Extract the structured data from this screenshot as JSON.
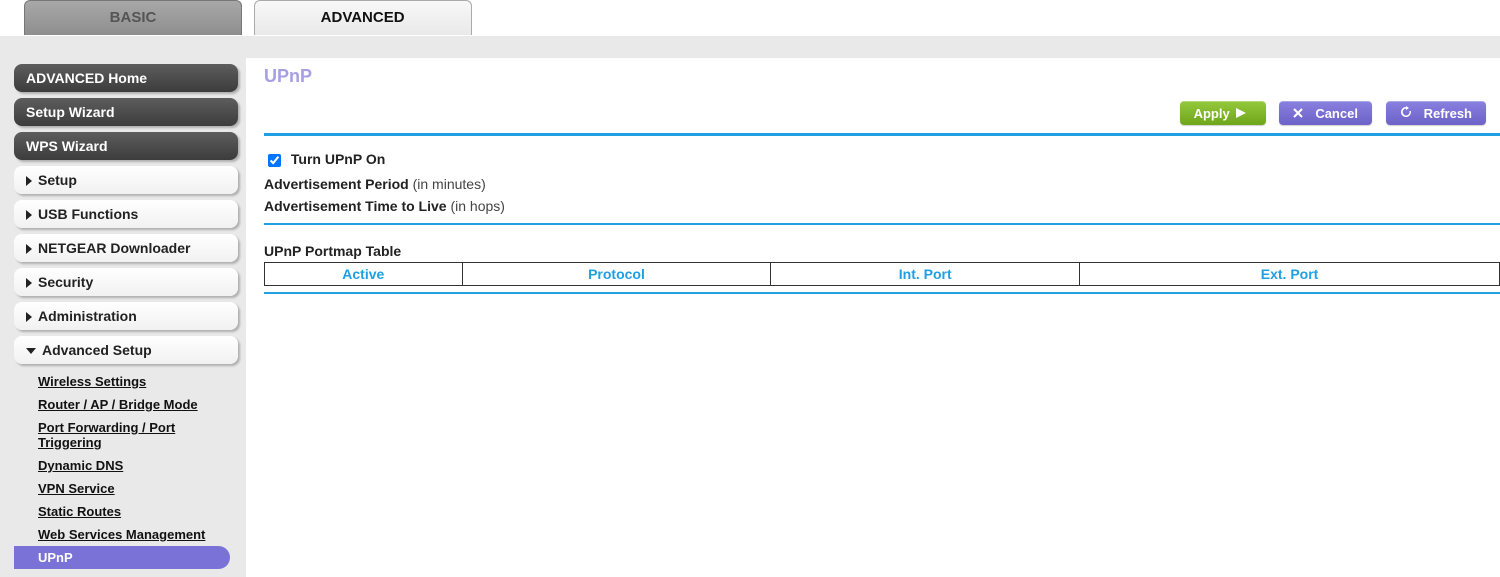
{
  "tabs": {
    "basic": "BASIC",
    "advanced": "ADVANCED"
  },
  "sidebar": {
    "advanced_home": "ADVANCED Home",
    "setup_wizard": "Setup Wizard",
    "wps_wizard": "WPS Wizard",
    "setup": "Setup",
    "usb": "USB Functions",
    "downloader": "NETGEAR Downloader",
    "security": "Security",
    "administration": "Administration",
    "adv_setup": "Advanced Setup",
    "subs": {
      "wireless": "Wireless Settings",
      "mode": "Router / AP / Bridge Mode",
      "portfwd": "Port Forwarding / Port Triggering",
      "ddns": "Dynamic DNS",
      "vpn": "VPN Service",
      "routes": "Static Routes",
      "wsm": "Web Services Management",
      "upnp": "UPnP"
    }
  },
  "page": {
    "title": "UPnP",
    "apply": "Apply",
    "cancel": "Cancel",
    "refresh": "Refresh",
    "turn_on": "Turn UPnP On",
    "adv_period": "Advertisement Period",
    "adv_period_hint": "(in minutes)",
    "ttl": "Advertisement Time to Live",
    "ttl_hint": "(in hops)",
    "table_title": "UPnP Portmap Table",
    "cols": {
      "active": "Active",
      "protocol": "Protocol",
      "intport": "Int. Port",
      "extport": "Ext. Port"
    }
  }
}
